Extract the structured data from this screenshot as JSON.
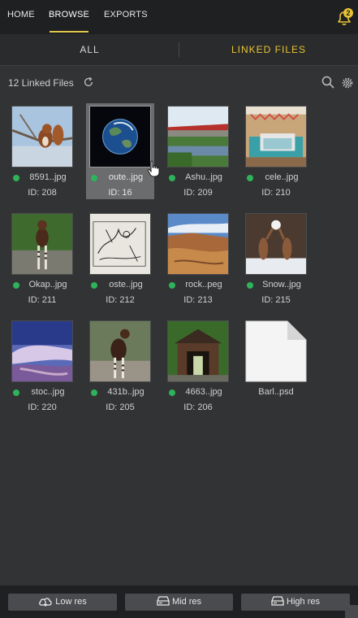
{
  "nav": {
    "tabs": [
      {
        "label": "HOME"
      },
      {
        "label": "BROWSE",
        "active": true
      },
      {
        "label": "EXPORTS"
      }
    ],
    "notification_count": "2"
  },
  "subtabs": {
    "all_label": "ALL",
    "linked_label": "LINKED FILES"
  },
  "header": {
    "count_label": "12 Linked Files"
  },
  "files": [
    {
      "name": "8591..jpg",
      "id": "ID: 208",
      "linked": true,
      "thumb": "squirrel"
    },
    {
      "name": "oute..jpg",
      "id": "ID: 16",
      "linked": true,
      "thumb": "earth",
      "selected": true
    },
    {
      "name": "Ashu..jpg",
      "id": "ID: 209",
      "linked": true,
      "thumb": "bridge"
    },
    {
      "name": "cele..jpg",
      "id": "ID: 210",
      "linked": true,
      "thumb": "bedroom"
    },
    {
      "name": "Okap..jpg",
      "id": "ID: 211",
      "linked": true,
      "thumb": "okapi"
    },
    {
      "name": "oste..jpg",
      "id": "ID: 212",
      "linked": true,
      "thumb": "sketch"
    },
    {
      "name": "rock..peg",
      "id": "ID: 213",
      "linked": true,
      "thumb": "canyon"
    },
    {
      "name": "Snow..jpg",
      "id": "ID: 215",
      "linked": true,
      "thumb": "squirrels-snow"
    },
    {
      "name": "stoc..jpg",
      "id": "ID: 220",
      "linked": true,
      "thumb": "sky"
    },
    {
      "name": "431b..jpg",
      "id": "ID: 205",
      "linked": true,
      "thumb": "okapi-standing"
    },
    {
      "name": "4663..jpg",
      "id": "ID: 206",
      "linked": true,
      "thumb": "covered-bridge"
    },
    {
      "name": "Barl..psd",
      "id": "",
      "linked": false,
      "thumb": "blank-file"
    }
  ],
  "bottom": {
    "low_label": "Low res",
    "mid_label": "Mid res",
    "high_label": "High res"
  },
  "colors": {
    "accent": "#e8c233",
    "linked_dot": "#2fb35a",
    "background": "#323335",
    "bar": "#1f2021"
  },
  "icons": [
    "bell-icon",
    "refresh-icon",
    "search-icon",
    "gear-icon",
    "cloud-download-icon",
    "drive-icon",
    "hand-cursor-icon",
    "file-icon"
  ]
}
